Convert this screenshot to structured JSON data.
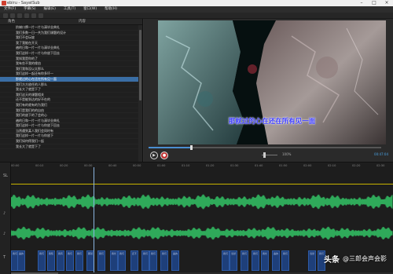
{
  "window": {
    "title": "ebiru - SayatSub",
    "menu": [
      "文件(F)",
      "字幕(S)",
      "编辑(E)",
      "工具(T)",
      "窗口(W)",
      "帮助(H)"
    ]
  },
  "subtitle_list": {
    "columns": [
      "",
      "角色",
      "内容"
    ],
    "rows": [
      {
        "text": "阶梯口牌一片一片与清毕业典礼"
      },
      {
        "text": "我们多数一日一共为我们课题的设计"
      },
      {
        "text": "我们不会玩坡"
      },
      {
        "text": "我了我能在开天"
      },
      {
        "text": "遍的日和一片一片与清毕业典礼"
      },
      {
        "text": "我们这样一片一片与你放下回去"
      },
      {
        "text": "我知我是你的了"
      },
      {
        "text": "我有些不我的缘由"
      },
      {
        "text": "我们我和没以太那么"
      },
      {
        "text": "我们这样一起还有你多坏一"
      },
      {
        "text": "那就过的心在还在所有见一面",
        "selected": true
      },
      {
        "text": "我们方方放任的人那么"
      },
      {
        "text": "我长大了就是下了"
      },
      {
        "text": "我们这天的课题相关"
      },
      {
        "text": "还不是能到达的好不在的"
      },
      {
        "text": "我们有的就有的为我们"
      },
      {
        "text": "我们是我们的的自由"
      },
      {
        "text": "我们的放下的了会的心"
      },
      {
        "text": "遍的日和一片一片与清毕业典礼"
      },
      {
        "text": "我们这样一片一片与你放下回去"
      },
      {
        "text": "当然遇到某人我们会同时有"
      },
      {
        "text": "我们这样一片一片与你放下"
      },
      {
        "text": "我们如何得我们一起"
      },
      {
        "text": "我长大了就是下了"
      }
    ]
  },
  "player": {
    "overlay_subtitle": "那就过的心在还在所有见一面",
    "volume_value": "100%",
    "timecode": "00:47:04",
    "seek_progress": 0.18
  },
  "timeline": {
    "ruler": [
      "00:00",
      "00:10",
      "00:20",
      "00:30",
      "00:40",
      "00:50",
      "01:00",
      "01:10",
      "01:20",
      "01:30",
      "01:40",
      "01:50",
      "02:00",
      "02:10",
      "02:20",
      "02:30"
    ],
    "lanes": [
      "SL",
      "♪",
      "♪",
      "T"
    ],
    "blocks": [
      "我们",
      "遍的",
      "我们",
      "我知",
      "我有",
      "我们",
      "我们",
      "那就",
      "我们",
      "我长",
      "我们",
      "还不",
      "我们",
      "我们",
      "我们",
      "遍的",
      "我们",
      "当然",
      "我们",
      "我们",
      "我长",
      "遍的",
      "我们",
      "当然",
      "我们"
    ]
  },
  "watermark": {
    "brand": "头条",
    "handle": "@三郎会声会影"
  },
  "colors": {
    "accent": "#3a6ea5",
    "waveform": "#2faa5a",
    "subtitle_block": "#1e3f7a",
    "overlay_text": "#3c3cff"
  }
}
